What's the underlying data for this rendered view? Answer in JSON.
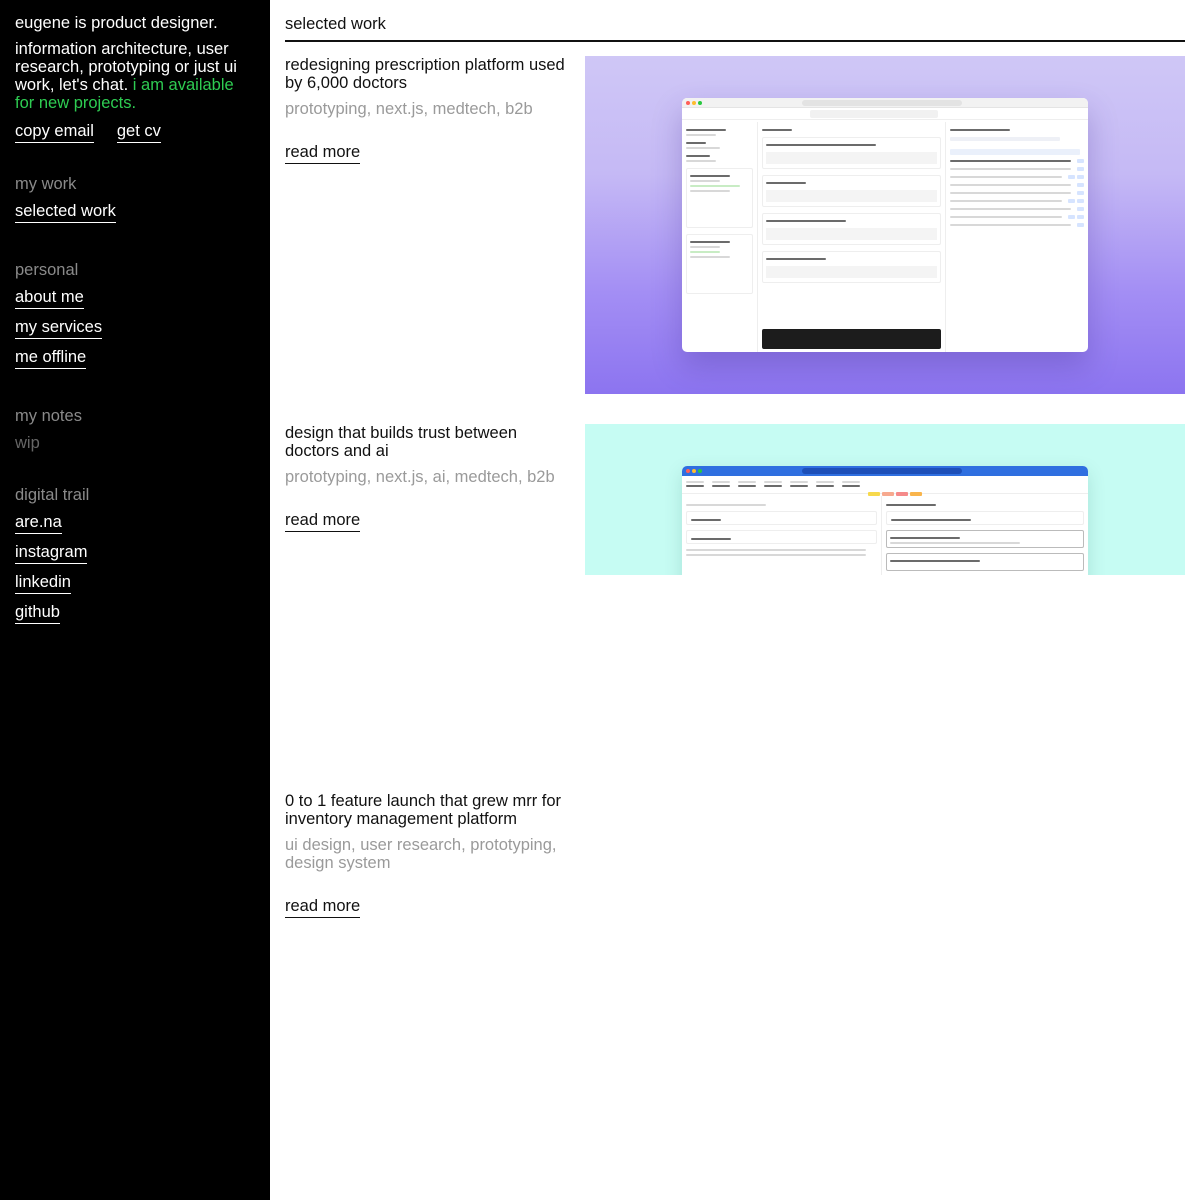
{
  "sidebar": {
    "intro_name": "eugene is product designer.",
    "intro_text": "information architecture, user research, prototyping or just ui work, let's chat.",
    "intro_available": "i am available for new projects.",
    "copy_email": "copy email",
    "get_cv": "get cv",
    "sections": {
      "my_work": {
        "title": "my work",
        "items": [
          "selected work"
        ]
      },
      "personal": {
        "title": "personal",
        "items": [
          "about me",
          "my services",
          "me offline"
        ]
      },
      "my_notes": {
        "title": "my notes",
        "items": [
          "wip"
        ]
      },
      "digital_trail": {
        "title": "digital trail",
        "items": [
          "are.na",
          "instagram",
          "linkedin",
          "github"
        ]
      }
    }
  },
  "main": {
    "title": "selected work",
    "projects": [
      {
        "title": "redesigning prescription platform used by 6,000 doctors",
        "tags": "prototyping, next.js, medtech, b2b",
        "read_more": "read more",
        "image_bg": "#c5b9f5"
      },
      {
        "title": "design that builds trust between doctors and ai",
        "tags": "prototyping, next.js, ai, medtech, b2b",
        "read_more": "read more",
        "image_bg": "#c6fcf3"
      },
      {
        "title": "0 to 1 feature launch that grew mrr for inventory management platform",
        "tags": "ui design, user research, prototyping, design system",
        "read_more": "read more"
      }
    ]
  },
  "colors": {
    "sidebar_bg": "#000000",
    "available_green": "#2ecc52",
    "muted_gray": "#8a8a8a",
    "tag_gray": "#9a9a9a"
  }
}
